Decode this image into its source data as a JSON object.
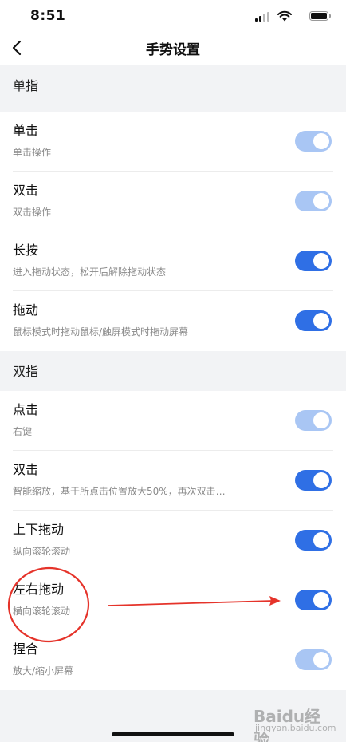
{
  "status_bar": {
    "time": "8:51"
  },
  "nav": {
    "title": "手势设置"
  },
  "sections": [
    {
      "header": "单指",
      "rows": [
        {
          "title": "单击",
          "desc": "单击操作",
          "enabled": true,
          "locked": true
        },
        {
          "title": "双击",
          "desc": "双击操作",
          "enabled": true,
          "locked": true
        },
        {
          "title": "长按",
          "desc": "进入拖动状态，松开后解除拖动状态",
          "enabled": true,
          "locked": false
        },
        {
          "title": "拖动",
          "desc": "鼠标模式时拖动鼠标/触屏模式时拖动屏幕",
          "enabled": true,
          "locked": false
        }
      ]
    },
    {
      "header": "双指",
      "rows": [
        {
          "title": "点击",
          "desc": "右键",
          "enabled": true,
          "locked": true
        },
        {
          "title": "双击",
          "desc": "智能缩放，基于所点击位置放大50%，再次双击…",
          "enabled": true,
          "locked": false
        },
        {
          "title": "上下拖动",
          "desc": "纵向滚轮滚动",
          "enabled": true,
          "locked": false
        },
        {
          "title": "左右拖动",
          "desc": "横向滚轮滚动",
          "enabled": true,
          "locked": false
        },
        {
          "title": "捏合",
          "desc": "放大/缩小屏幕",
          "enabled": true,
          "locked": true
        }
      ]
    }
  ],
  "colors": {
    "toggle_on": "#2f6fe5",
    "toggle_disabled": "#a9c6f4",
    "annotation": "#e5332a"
  },
  "watermark": {
    "text": "Baidu经验",
    "sub": "jingyan.baidu.com"
  }
}
